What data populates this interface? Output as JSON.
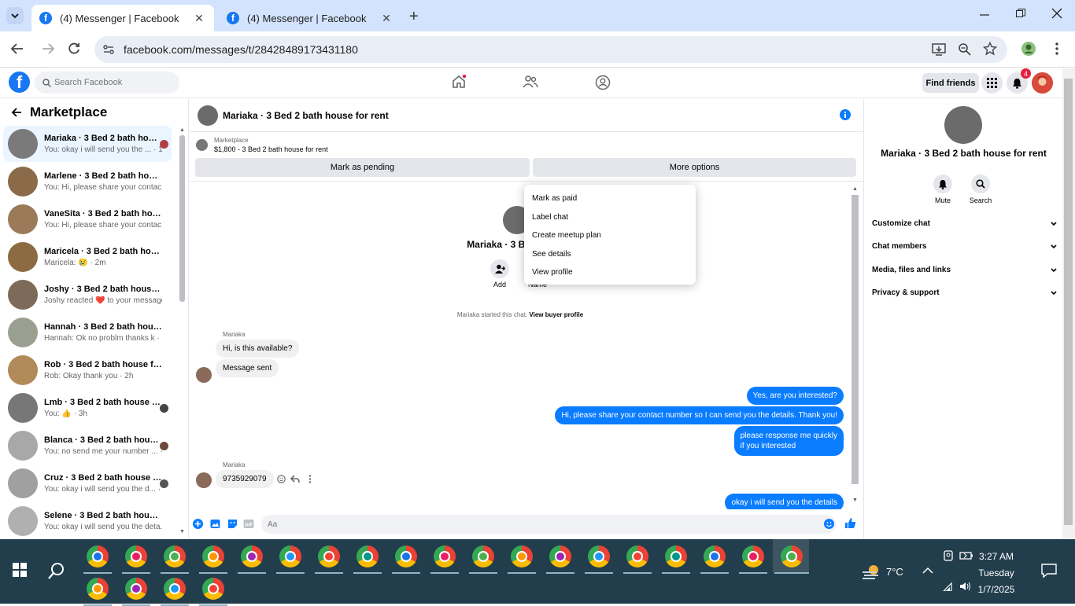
{
  "browser": {
    "tabs": [
      {
        "title": "(4) Messenger | Facebook",
        "active": true
      },
      {
        "title": "(4) Messenger | Facebook",
        "active": false
      }
    ],
    "url": "facebook.com/messages/t/28428489173431180"
  },
  "fb": {
    "search_placeholder": "Search Facebook",
    "find_friends": "Find friends",
    "notification_count": "4"
  },
  "sidebar": {
    "title": "Marketplace",
    "chats": [
      {
        "name": "Mariaka · 3 Bed 2 bath hous...",
        "preview": "You: okay i will send you the ... · 1m",
        "color": "#7a7a7a"
      },
      {
        "name": "Marlene · 3 Bed 2 bath house f...",
        "preview": "You: Hi, please share your contac... · 1m",
        "color": "#8a6a48"
      },
      {
        "name": "VaneSita · 3 Bed 2 bath house ...",
        "preview": "You: Hi, please share your contac... · 1m",
        "color": "#9a7a58"
      },
      {
        "name": "Maricela · 3 Bed 2 bath house f...",
        "preview": "Maricela: 😢 · 2m",
        "color": "#8c6a42"
      },
      {
        "name": "Joshy · 3 Bed 2 bath house for ...",
        "preview": "Joshy reacted ❤️ to your message · 1h",
        "color": "#7d6a58"
      },
      {
        "name": "Hannah · 3 Bed 2 bath house f...",
        "preview": "Hannah: Ok no problm thanks k · 2h",
        "color": "#9aa08f"
      },
      {
        "name": "Rob · 3 Bed 2 bath house for r...",
        "preview": "Rob: Okay thank you · 2h",
        "color": "#b08a58"
      },
      {
        "name": "Lmb · 3 Bed 2 bath house fo...",
        "preview": "You: 👍 · 3h",
        "color": "#777777"
      },
      {
        "name": "Blanca · 3 Bed 2 bath house ...",
        "preview": "You: no send me your number ... · 4h",
        "color": "#a8a8a8"
      },
      {
        "name": "Cruz · 3 Bed 2 bath house fo...",
        "preview": "You: okay i will send you the d... · 4h",
        "color": "#a0a0a0"
      },
      {
        "name": "Selene · 3 Bed 2 bath house fo...",
        "preview": "You: okay i will send you the deta... · 6h",
        "color": "#b0b0b0"
      }
    ]
  },
  "chat": {
    "title": "Mariaka · 3 Bed 2 bath house for rent",
    "marketplace_label": "Marketplace",
    "listing": "$1,800 - 3 Bed 2 bath house for rent",
    "mark_pending": "Mark as pending",
    "more_options": "More options",
    "profile_name": "Mariaka · 3 Bed 2 ba",
    "add_label": "Add",
    "name_label": "Name",
    "started_text": "Mariaka started this chat.",
    "view_buyer_profile": "View buyer profile",
    "sender": "Mariaka",
    "incoming1": "Hi, is this available?",
    "incoming2": "Message sent",
    "out1": "Yes, are you interested?",
    "out2": "Hi, please share your contact number so I can send you the details. Thank you!",
    "out3_line1": "please response me quickly",
    "out3_line2": "if you interested",
    "incoming3": "9735929079",
    "out4": "okay i will send you the details",
    "input_placeholder": "Aa"
  },
  "dropdown": {
    "items": [
      "Mark as paid",
      "Label chat",
      "Create meetup plan",
      "See details",
      "View profile"
    ]
  },
  "right_panel": {
    "title": "Mariaka · 3 Bed 2 bath house for rent",
    "mute": "Mute",
    "search": "Search",
    "rows": [
      "Customize chat",
      "Chat members",
      "Media, files and links",
      "Privacy & support"
    ]
  },
  "taskbar": {
    "temperature": "7°C",
    "time": "3:27 AM",
    "day": "Tuesday",
    "date": "1/7/2025"
  },
  "colors": {
    "fb_blue": "#1877f2",
    "messenger_blue": "#0a7cff",
    "taskbar": "#223e4c"
  }
}
